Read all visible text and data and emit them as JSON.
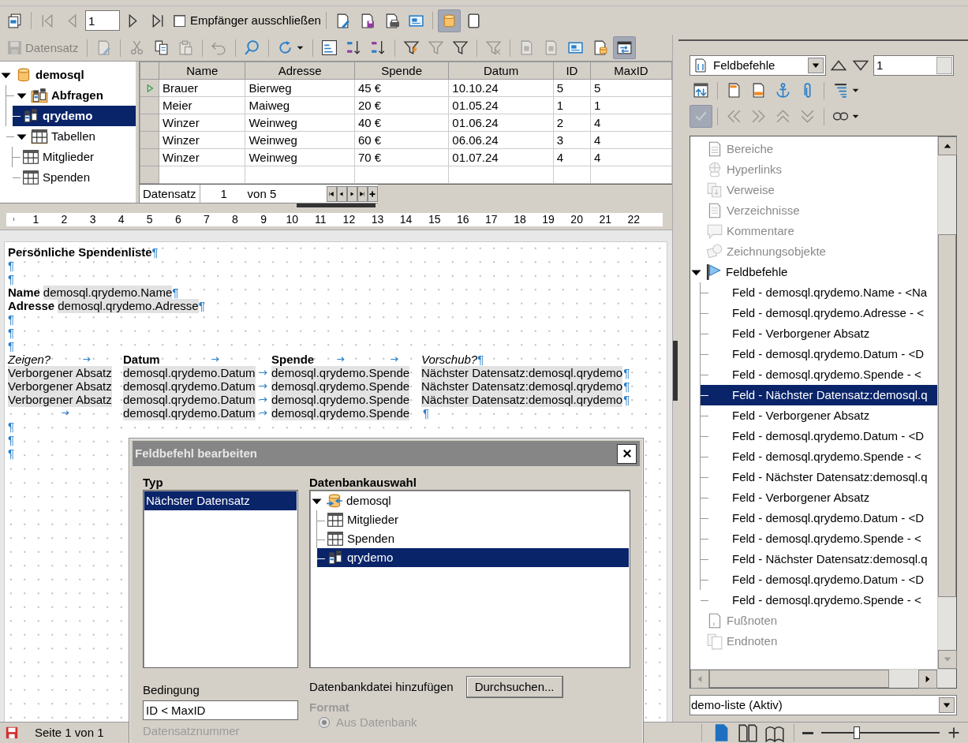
{
  "toolbar_mail_merge": {
    "items": [
      {
        "kind": "pages",
        "disabled": false,
        "active": false
      },
      {
        "kind": "sep"
      },
      {
        "kind": "first",
        "disabled": true,
        "active": false
      },
      {
        "kind": "prev",
        "disabled": true,
        "active": false
      },
      {
        "kind": "field",
        "value": "1"
      },
      {
        "kind": "next",
        "disabled": false,
        "active": false
      },
      {
        "kind": "last",
        "disabled": false,
        "active": false
      },
      {
        "kind": "checkbox",
        "label": "Empfänger ausschließen",
        "checked": false
      },
      {
        "kind": "sep"
      },
      {
        "kind": "docpen",
        "disabled": false,
        "active": false
      },
      {
        "kind": "docsave",
        "disabled": false,
        "active": false
      },
      {
        "kind": "docprint",
        "disabled": false,
        "active": false
      },
      {
        "kind": "card",
        "disabled": false,
        "active": false
      },
      {
        "kind": "sep"
      },
      {
        "kind": "database",
        "disabled": false,
        "active": true
      },
      {
        "kind": "page",
        "disabled": false,
        "active": false
      }
    ]
  },
  "toolbar_data": {
    "items": [
      {
        "kind": "disk",
        "label": "Datensatz",
        "disabled": true,
        "active": false
      },
      {
        "kind": "sep"
      },
      {
        "kind": "docpen",
        "disabled": true,
        "active": false
      },
      {
        "kind": "sep"
      },
      {
        "kind": "scissors",
        "disabled": true,
        "active": false
      },
      {
        "kind": "copy",
        "disabled": false,
        "active": false
      },
      {
        "kind": "paste",
        "disabled": true,
        "active": false
      },
      {
        "kind": "sep"
      },
      {
        "kind": "undo",
        "disabled": true,
        "active": false
      },
      {
        "kind": "sep"
      },
      {
        "kind": "search",
        "disabled": false,
        "active": false
      },
      {
        "kind": "sep"
      },
      {
        "kind": "refresh",
        "disabled": false,
        "active": false,
        "caret": true
      },
      {
        "kind": "sep"
      },
      {
        "kind": "sortbox",
        "disabled": false,
        "active": false
      },
      {
        "kind": "sortasc",
        "disabled": false,
        "active": false
      },
      {
        "kind": "sortdesc",
        "disabled": false,
        "active": false
      },
      {
        "kind": "sep"
      },
      {
        "kind": "filterauto",
        "disabled": false,
        "active": false
      },
      {
        "kind": "filter",
        "disabled": true,
        "active": false
      },
      {
        "kind": "filter",
        "disabled": false,
        "active": false
      },
      {
        "kind": "sep"
      },
      {
        "kind": "filterx",
        "disabled": true,
        "active": false
      },
      {
        "kind": "sep"
      },
      {
        "kind": "docgrey",
        "disabled": true,
        "active": false
      },
      {
        "kind": "docgrey",
        "disabled": true,
        "active": false
      },
      {
        "kind": "card",
        "disabled": false,
        "active": false
      },
      {
        "kind": "docdb",
        "disabled": false,
        "active": false
      },
      {
        "kind": "explorer",
        "disabled": false,
        "active": true
      }
    ]
  },
  "data_source_tree": [
    {
      "label": "demosql",
      "kind": "database",
      "bold": true,
      "expanded": true,
      "selected": false,
      "children": [
        {
          "label": "Abfragen",
          "kind": "queryfolder",
          "bold": true,
          "expanded": true,
          "selected": false,
          "children": [
            {
              "label": "qrydemo",
              "kind": "query",
              "bold": true,
              "selected": true
            }
          ]
        },
        {
          "label": "Tabellen",
          "kind": "tablefolder",
          "bold": false,
          "expanded": true,
          "selected": false,
          "children": [
            {
              "label": "Mitglieder",
              "kind": "table",
              "bold": false,
              "selected": false
            },
            {
              "label": "Spenden",
              "kind": "table",
              "bold": false,
              "selected": false
            }
          ]
        }
      ]
    }
  ],
  "data_grid": {
    "columns": [
      "Name",
      "Adresse",
      "Spende",
      "Datum",
      "ID",
      "MaxID"
    ],
    "rows": [
      {
        "current": true,
        "cells": [
          "Brauer",
          "Bierweg",
          "45 €",
          "10.10.24",
          "5",
          "5"
        ]
      },
      {
        "current": false,
        "cells": [
          "Meier",
          "Maiweg",
          "20 €",
          "01.05.24",
          "1",
          "1"
        ]
      },
      {
        "current": false,
        "cells": [
          "Winzer",
          "Weinweg",
          "40 €",
          "01.06.24",
          "2",
          "4"
        ]
      },
      {
        "current": false,
        "cells": [
          "Winzer",
          "Weinweg",
          "60 €",
          "06.06.24",
          "3",
          "4"
        ]
      },
      {
        "current": false,
        "cells": [
          "Winzer",
          "Weinweg",
          "70 €",
          "01.07.24",
          "4",
          "4"
        ]
      }
    ],
    "footer": {
      "label": "Datensatz",
      "record": "1",
      "count": "von 5"
    }
  },
  "ruler": {
    "labels": [
      "1",
      "2",
      "3",
      "4",
      "5",
      "6",
      "7",
      "8",
      "9",
      "10",
      "11",
      "12",
      "13",
      "14",
      "15",
      "16",
      "17",
      "18",
      "19",
      "20",
      "21",
      "22"
    ]
  },
  "document": {
    "paragraphs": [
      {
        "kind": "line",
        "segments": [
          {
            "kind": "bold",
            "text": "Persönliche Spendenliste"
          }
        ],
        "end_mark": "¶"
      },
      {
        "kind": "line",
        "end_mark": "¶"
      },
      {
        "kind": "line",
        "end_mark": "¶"
      },
      {
        "kind": "line",
        "segments": [
          {
            "kind": "bold",
            "text": "Name"
          },
          {
            "kind": "field",
            "text": "demosql.qrydemo.Name"
          }
        ],
        "end_mark": "¶"
      },
      {
        "kind": "line",
        "segments": [
          {
            "kind": "bold",
            "text": "Adresse"
          },
          {
            "kind": "field",
            "text": "demosql.qrydemo.Adresse"
          }
        ],
        "end_mark": "¶"
      },
      {
        "kind": "line",
        "end_mark": "¶"
      },
      {
        "kind": "line",
        "end_mark": "¶"
      },
      {
        "kind": "line",
        "end_mark": "¶"
      },
      {
        "kind": "tabbed",
        "cells": [
          [
            {
              "kind": "italic",
              "text": "Zeigen?"
            },
            {
              "kind": "tab"
            }
          ],
          [
            {
              "kind": "bold",
              "text": "Datum"
            },
            {
              "kind": "tab"
            }
          ],
          [
            {
              "kind": "bold",
              "text": "Spende"
            },
            {
              "kind": "tab"
            },
            {
              "kind": "tab"
            }
          ],
          [
            {
              "kind": "italic",
              "text": "Vorschub?"
            }
          ]
        ],
        "end_mark": "¶"
      },
      {
        "kind": "tabbed",
        "cells": [
          [
            {
              "kind": "field",
              "text": "Verborgener Absatz"
            }
          ],
          [
            {
              "kind": "field",
              "text": "demosql.qrydemo.Datum"
            },
            {
              "kind": "tab"
            }
          ],
          [
            {
              "kind": "field",
              "text": "demosql.qrydemo.Spende"
            }
          ],
          [
            {
              "kind": "field",
              "text": "Nächster Datensatz:demosql.qrydemo"
            }
          ]
        ],
        "end_mark": "¶"
      },
      {
        "kind": "tabbed",
        "cells": [
          [
            {
              "kind": "field",
              "text": "Verborgener Absatz"
            }
          ],
          [
            {
              "kind": "field",
              "text": "demosql.qrydemo.Datum"
            },
            {
              "kind": "tab"
            }
          ],
          [
            {
              "kind": "field",
              "text": "demosql.qrydemo.Spende"
            }
          ],
          [
            {
              "kind": "field",
              "text": "Nächster Datensatz:demosql.qrydemo"
            }
          ]
        ],
        "end_mark": "¶"
      },
      {
        "kind": "tabbed",
        "cells": [
          [
            {
              "kind": "field",
              "text": "Verborgener Absatz"
            }
          ],
          [
            {
              "kind": "field",
              "text": "demosql.qrydemo.Datum"
            },
            {
              "kind": "tab"
            }
          ],
          [
            {
              "kind": "field",
              "text": "demosql.qrydemo.Spende"
            }
          ],
          [
            {
              "kind": "field",
              "text": "Nächster Datensatz:demosql.qrydemo"
            }
          ]
        ],
        "end_mark": "¶"
      },
      {
        "kind": "tabbed",
        "cells": [
          [
            {
              "kind": "tab"
            }
          ],
          [
            {
              "kind": "field",
              "text": "demosql.qrydemo.Datum"
            },
            {
              "kind": "tab"
            }
          ],
          [
            {
              "kind": "field",
              "text": "demosql.qrydemo.Spende"
            }
          ],
          []
        ],
        "end_mark": "¶"
      },
      {
        "kind": "line",
        "end_mark": "¶"
      },
      {
        "kind": "line",
        "end_mark": "¶"
      },
      {
        "kind": "line",
        "end_mark": "¶"
      }
    ]
  },
  "navigator": {
    "content_dropdown": "Feldbefehle",
    "spin_value": "1",
    "toolbar_rows": [
      [
        {
          "kind": "toggle",
          "disabled": false,
          "active": false
        },
        {
          "kind": "sep"
        },
        {
          "kind": "headerpage",
          "disabled": false,
          "active": false
        },
        {
          "kind": "footerpage",
          "disabled": false,
          "active": false
        },
        {
          "kind": "anchor",
          "disabled": false,
          "active": false
        },
        {
          "kind": "clip",
          "disabled": false,
          "active": false
        },
        {
          "kind": "sep"
        },
        {
          "kind": "headings",
          "disabled": false,
          "active": false,
          "caret": true
        }
      ],
      [
        {
          "kind": "check",
          "disabled": true,
          "active": true
        },
        {
          "kind": "sep"
        },
        {
          "kind": "chevl",
          "disabled": true,
          "active": false
        },
        {
          "kind": "chevr",
          "disabled": true,
          "active": false
        },
        {
          "kind": "chevu",
          "disabled": true,
          "active": false
        },
        {
          "kind": "chevd",
          "disabled": true,
          "active": false
        },
        {
          "kind": "sep"
        },
        {
          "kind": "link",
          "disabled": false,
          "active": false,
          "caret": true
        }
      ]
    ],
    "tree": [
      {
        "label": "Bereiche",
        "kind": "section",
        "disabled": true,
        "selected": false
      },
      {
        "label": "Hyperlinks",
        "kind": "hyperlink",
        "disabled": true,
        "selected": false
      },
      {
        "label": "Verweise",
        "kind": "reference",
        "disabled": true,
        "selected": false
      },
      {
        "label": "Verzeichnisse",
        "kind": "index",
        "disabled": true,
        "selected": false
      },
      {
        "label": "Kommentare",
        "kind": "comment",
        "disabled": true,
        "selected": false
      },
      {
        "label": "Zeichnungsobjekte",
        "kind": "drawing",
        "disabled": true,
        "selected": false
      },
      {
        "label": "Feldbefehle",
        "kind": "flag",
        "disabled": false,
        "selected": false,
        "expanded": true,
        "children": [
          {
            "label": "Feld - demosql.qrydemo.Name - <Na",
            "disabled": false,
            "selected": false
          },
          {
            "label": "Feld - demosql.qrydemo.Adresse - <",
            "disabled": false,
            "selected": false
          },
          {
            "label": "Feld - Verborgener Absatz",
            "disabled": false,
            "selected": false
          },
          {
            "label": "Feld - demosql.qrydemo.Datum - <D",
            "disabled": false,
            "selected": false
          },
          {
            "label": "Feld - demosql.qrydemo.Spende - <",
            "disabled": false,
            "selected": false
          },
          {
            "label": "Feld - Nächster Datensatz:demosql.q",
            "disabled": false,
            "selected": true
          },
          {
            "label": "Feld - Verborgener Absatz",
            "disabled": false,
            "selected": false
          },
          {
            "label": "Feld - demosql.qrydemo.Datum - <D",
            "disabled": false,
            "selected": false
          },
          {
            "label": "Feld - demosql.qrydemo.Spende - <",
            "disabled": false,
            "selected": false
          },
          {
            "label": "Feld - Nächster Datensatz:demosql.q",
            "disabled": false,
            "selected": false
          },
          {
            "label": "Feld - Verborgener Absatz",
            "disabled": false,
            "selected": false
          },
          {
            "label": "Feld - demosql.qrydemo.Datum - <D",
            "disabled": false,
            "selected": false
          },
          {
            "label": "Feld - demosql.qrydemo.Spende - <",
            "disabled": false,
            "selected": false
          },
          {
            "label": "Feld - Nächster Datensatz:demosql.q",
            "disabled": false,
            "selected": false
          },
          {
            "label": "Feld - demosql.qrydemo.Datum - <D",
            "disabled": false,
            "selected": false
          },
          {
            "label": "Feld - demosql.qrydemo.Spende - <",
            "disabled": false,
            "selected": false
          }
        ]
      },
      {
        "label": "Fußnoten",
        "kind": "footnote",
        "disabled": true,
        "selected": false
      },
      {
        "label": "Endnoten",
        "kind": "endnote",
        "disabled": true,
        "selected": false
      }
    ],
    "document_dropdown": "demo-liste (Aktiv)"
  },
  "dialog": {
    "title": "Feldbefehl bearbeiten",
    "type_label": "Typ",
    "types": [
      {
        "label": "Nächster Datensatz",
        "selected": true
      }
    ],
    "db_label": "Datenbankauswahl",
    "db_tree": [
      {
        "label": "demosql",
        "kind": "dbconn",
        "bold": false,
        "expanded": true,
        "selected": false,
        "children": [
          {
            "label": "Mitglieder",
            "kind": "table",
            "bold": false,
            "selected": false
          },
          {
            "label": "Spenden",
            "kind": "table",
            "bold": false,
            "selected": false
          },
          {
            "label": "qrydemo",
            "kind": "query",
            "bold": false,
            "selected": true
          }
        ]
      }
    ],
    "condition_label": "Bedingung",
    "condition_value": "ID < MaxID",
    "record_number_label": "Datensatznummer",
    "add_db_label": "Datenbankdatei hinzufügen",
    "browse_button": "Durchsuchen...",
    "format_label": "Format",
    "format_option": {
      "label": "Aus Datenbank",
      "checked": true,
      "disabled": true
    }
  },
  "status_bar": {
    "page": "Seite 1 von 1",
    "views": [
      {
        "kind": "single",
        "selected": true
      },
      {
        "kind": "multi",
        "selected": false
      },
      {
        "kind": "book",
        "selected": false
      }
    ],
    "zoom": {
      "level": 0.3
    }
  }
}
